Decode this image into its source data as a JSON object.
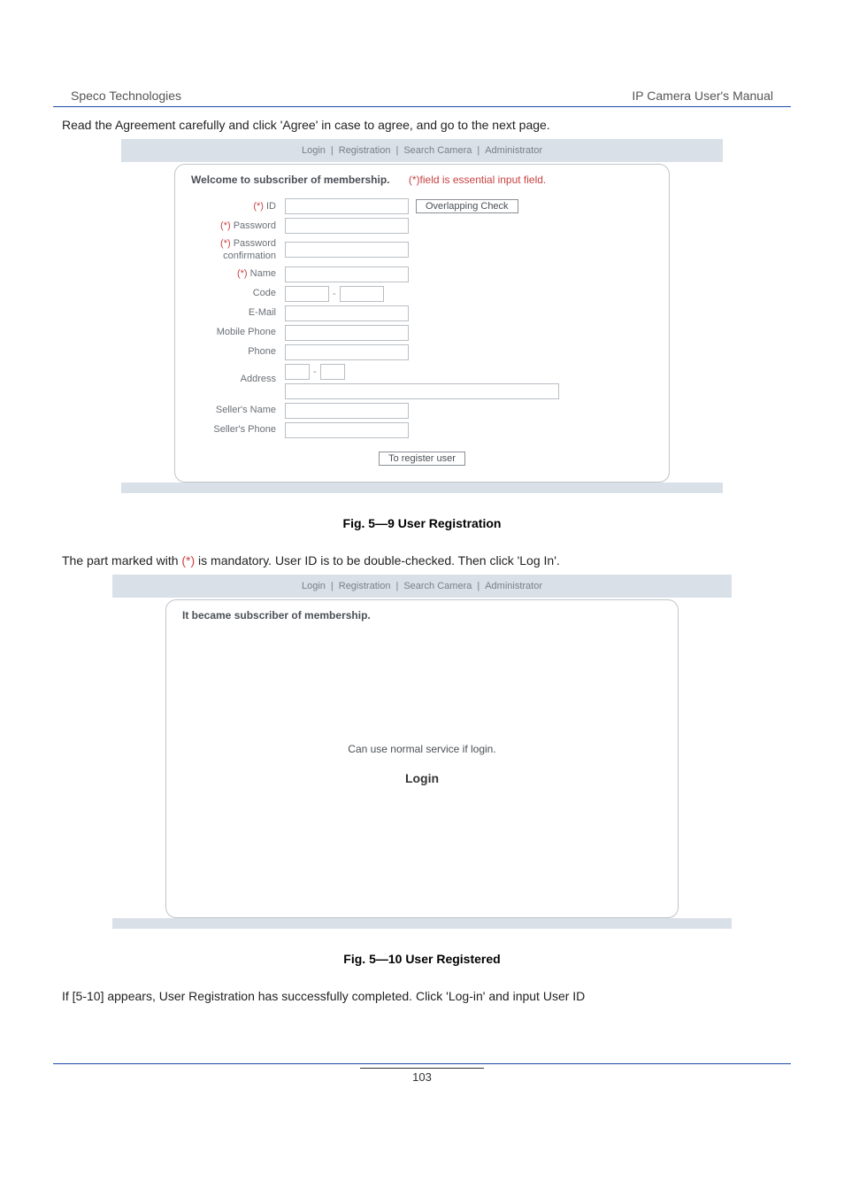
{
  "header": {
    "left": "Speco Technologies",
    "right": "IP Camera User's Manual"
  },
  "instr1": "Read the Agreement carefully and click 'Agree' in case to agree, and go to the next page.",
  "topnav": {
    "login": "Login",
    "registration": "Registration",
    "search": "Search Camera",
    "admin": "Administrator",
    "sep": " | "
  },
  "form1": {
    "welcome_bold": "Welcome to subscriber of membership.",
    "welcome_red": "(*)field is essential input field.",
    "labels": {
      "id_star": "(*)",
      "id": " ID",
      "pw_star": "(*)",
      "pw": " Password",
      "pwc_star": "(*)",
      "pwc_a": " Password",
      "pwc_b": "confirmation",
      "name_star": "(*)",
      "name": " Name",
      "code": "Code",
      "email": "E-Mail",
      "mphone": "Mobile Phone",
      "phone": "Phone",
      "address": "Address",
      "sname": "Seller's Name",
      "sphone": "Seller's Phone"
    },
    "overlap_btn": "Overlapping Check",
    "register_btn": "To register user",
    "dash": "-"
  },
  "fig1": "Fig.  5—9   User Registration",
  "instr2_a": "The part marked with ",
  "instr2_b": "(*)",
  "instr2_c": " is mandatory. User ID is to be double-checked. Then click 'Log In'.",
  "form2": {
    "title": "It became subscriber of membership.",
    "line": "Can use normal service if login.",
    "login": "Login"
  },
  "fig2": "Fig.  5—10 User Registered",
  "instr3": "If [5-10] appears, User Registration has successfully completed. Click 'Log-in' and input User ID",
  "page_num": "103"
}
